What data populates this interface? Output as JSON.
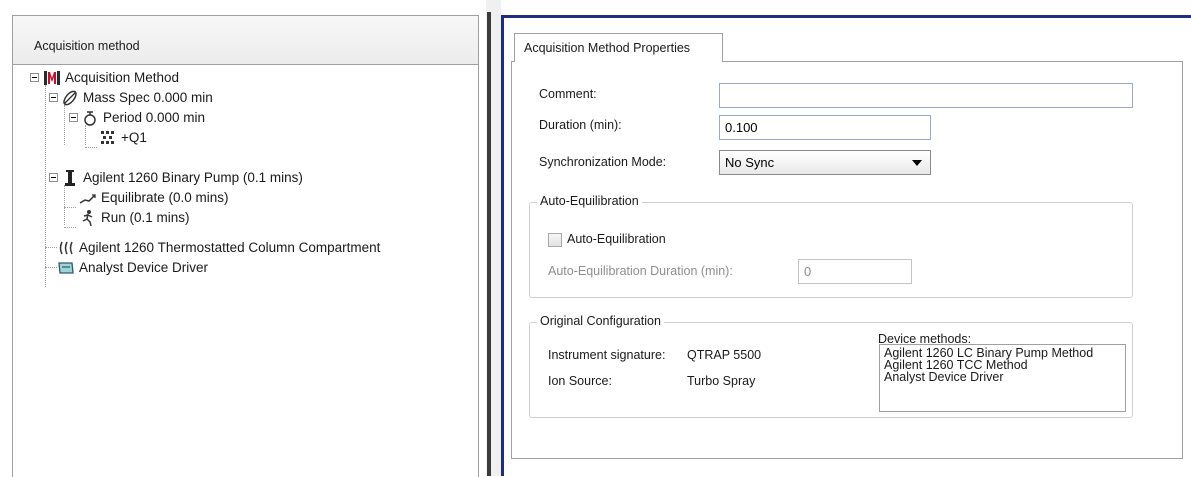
{
  "left_panel": {
    "header": "Acquisition method",
    "tree": [
      {
        "label": "Acquisition Method",
        "icon": "acquisition-method-icon"
      },
      {
        "label": "Mass Spec  0.000 min",
        "icon": "mass-spec-icon"
      },
      {
        "label": "Period  0.000 min",
        "icon": "period-icon"
      },
      {
        "label": "+Q1",
        "icon": "experiment-icon"
      },
      {
        "label": "Agilent 1260 Binary Pump (0.1 mins)",
        "icon": "pump-icon"
      },
      {
        "label": "Equilibrate (0.0 mins)",
        "icon": "equilibrate-icon"
      },
      {
        "label": "Run (0.1 mins)",
        "icon": "run-icon"
      },
      {
        "label": "Agilent 1260 Thermostatted Column Compartment",
        "icon": "column-compartment-icon"
      },
      {
        "label": "Analyst Device Driver",
        "icon": "device-driver-icon"
      }
    ]
  },
  "right_panel": {
    "tab_label": "Acquisition Method Properties",
    "comment": {
      "label": "Comment:",
      "value": ""
    },
    "duration": {
      "label": "Duration (min):",
      "value": "0.100"
    },
    "sync_mode": {
      "label": "Synchronization Mode:",
      "value": "No Sync"
    },
    "auto_equilibration": {
      "group_title": "Auto-Equilibration",
      "checkbox_label": "Auto-Equilibration",
      "checked": false,
      "duration_label": "Auto-Equilibration Duration (min):",
      "duration_value": "0"
    },
    "original_configuration": {
      "group_title": "Original Configuration",
      "instrument_signature_label": "Instrument signature:",
      "instrument_signature_value": "QTRAP 5500",
      "ion_source_label": "Ion Source:",
      "ion_source_value": "Turbo Spray",
      "device_methods_label": "Device methods:",
      "device_methods": [
        "Agilent 1260 LC Binary Pump Method",
        "Agilent 1260 TCC Method",
        "Analyst Device Driver"
      ]
    }
  },
  "colors": {
    "accent_border": "#1d2d80",
    "method_icon_red": "#c8102e"
  }
}
